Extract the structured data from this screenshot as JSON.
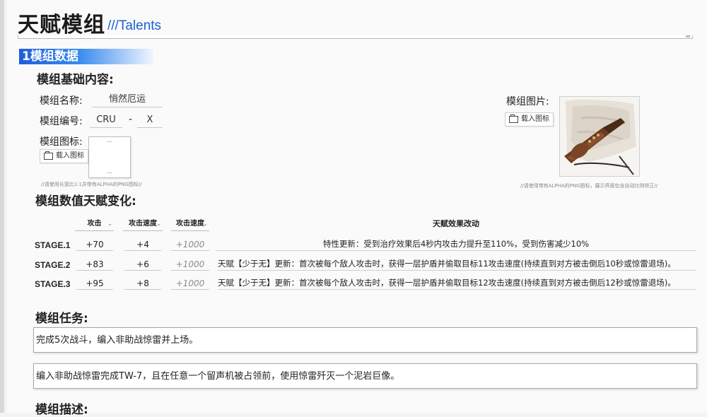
{
  "page": {
    "title": "天赋模组",
    "subtitle": "///Talents"
  },
  "section": {
    "number_title": "1模组数据"
  },
  "basic": {
    "heading": "模组基础内容:",
    "name_label": "模组名称:",
    "name_value": "悄然厄运",
    "code_label": "模组编号:",
    "code_prefix": "CRU",
    "code_separator": "-",
    "code_suffix": "X",
    "icon_label": "模组图标:",
    "icon_load_button": "载入图标",
    "icon_hint": "//请使用长宽比1:1并带有ALPHA的PNG图标//",
    "image_label": "模组图片:",
    "image_load_button": "载入图标",
    "image_hint": "//请使用带有ALPHA的PNG图标，展示界面包含自动比例矫正//"
  },
  "talent_changes": {
    "heading": "模组数值天赋变化:",
    "columns": [
      "攻击",
      "攻击速度",
      "攻击速度"
    ],
    "effect_header": "天赋效果改动",
    "rows": [
      {
        "stage": "STAGE.1",
        "attack": "+70",
        "attack_speed": "+4",
        "extra": "+1000",
        "effect": "特性更新：受到治疗效果后4秒内攻击力提升至110%，受到伤害减少10%"
      },
      {
        "stage": "STAGE.2",
        "attack": "+83",
        "attack_speed": "+6",
        "extra": "+1000",
        "effect": "天赋【少于无】更新：首次被每个敌人攻击时，获得一层护盾并偷取目标11攻击速度(持续直到对方被击倒后10秒或惊雷退场)。"
      },
      {
        "stage": "STAGE.3",
        "attack": "+95",
        "attack_speed": "+8",
        "extra": "+1000",
        "effect": "天赋【少于无】更新：首次被每个敌人攻击时，获得一层护盾并偷取目标12攻击速度(持续直到对方被击倒后12秒或惊雷退场)。"
      }
    ]
  },
  "tasks": {
    "heading": "模组任务:",
    "items": [
      "完成5次战斗，编入非助战惊雷并上场。",
      "编入非助战惊雷完成TW-7，且在任意一个留声机被占领前，使用惊雷歼灭一个泥岩巨像。"
    ]
  },
  "description": {
    "heading": "模组描述:"
  },
  "icons": {
    "load": "folder-icon",
    "dropdown": "chevron-down-icon"
  },
  "colors": {
    "accent": "#1f5fd8",
    "subtitle": "#1c5fd1"
  }
}
